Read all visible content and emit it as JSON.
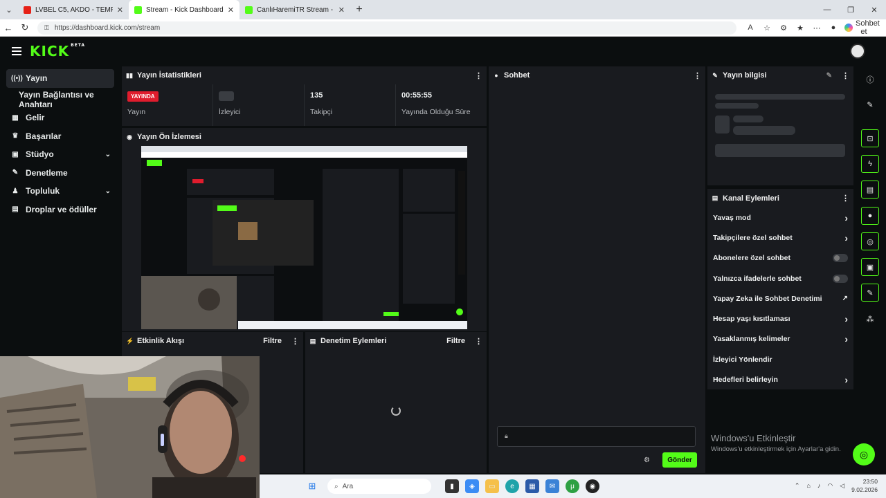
{
  "browser": {
    "tabs": [
      {
        "title": "LVBEL C5, AKDO - TEMPO - YouTu",
        "active": false,
        "favicon_color": "#e62117"
      },
      {
        "title": "Stream - Kick Dashboard",
        "active": true,
        "favicon_color": "#53fc18"
      },
      {
        "title": "CanlıHaremiTR Stream - Watch L",
        "active": false,
        "favicon_color": "#53fc18"
      }
    ],
    "url": "https://dashboard.kick.com/stream",
    "chat_label": "Sohbet et"
  },
  "header": {
    "logo": "KICK",
    "logo_badge": "BETA"
  },
  "sidebar": {
    "items": [
      {
        "label": "Yayın",
        "icon": "broadcast-icon"
      },
      {
        "label": "Yayın Bağlantısı ve Anahtarı",
        "icon": ""
      },
      {
        "label": "Gelir",
        "icon": "chart-icon"
      },
      {
        "label": "Başarılar",
        "icon": "trophy-icon"
      },
      {
        "label": "Stüdyo",
        "icon": "film-icon"
      },
      {
        "label": "Denetleme",
        "icon": "wrench-icon"
      },
      {
        "label": "Topluluk",
        "icon": "users-icon"
      },
      {
        "label": "Droplar ve ödüller",
        "icon": "gift-icon"
      }
    ]
  },
  "stats": {
    "title": "Yayın İstatistikleri",
    "live_badge": "YAYINDA",
    "items": [
      {
        "value": "",
        "label": "Yayın"
      },
      {
        "value": "",
        "label": "İzleyici"
      },
      {
        "value": "135",
        "label": "Takipçi"
      },
      {
        "value": "00:55:55",
        "label": "Yayında Olduğu Süre"
      }
    ]
  },
  "preview": {
    "title": "Yayın Ön İzlemesi"
  },
  "activity": {
    "title": "Etkinlik Akışı",
    "filter": "Filtre"
  },
  "moderation": {
    "title": "Denetim Eylemleri",
    "filter": "Filtre"
  },
  "chat": {
    "title": "Sohbet",
    "send": "Gönder"
  },
  "stream_info": {
    "title": "Yayın bilgisi"
  },
  "channel_actions": {
    "title": "Kanal Eylemleri",
    "items": [
      {
        "label": "Yavaş mod",
        "control": "chevron"
      },
      {
        "label": "Takipçilere özel sohbet",
        "control": "chevron"
      },
      {
        "label": "Abonelere özel sohbet",
        "control": "toggle"
      },
      {
        "label": "Yalnızca ifadelerle sohbet",
        "control": "toggle"
      },
      {
        "label": "Yapay Zeka ile Sohbet Denetimi",
        "control": "external"
      },
      {
        "label": "Hesap yaşı kısıtlaması",
        "control": "chevron"
      },
      {
        "label": "Yasaklanmış kelimeler",
        "control": "chevron"
      },
      {
        "label": "İzleyici Yönlendir",
        "control": "none"
      },
      {
        "label": "Hedefleri belirleyin",
        "control": "chevron"
      }
    ]
  },
  "windows_activation": {
    "title": "Windows'u Etkinleştir",
    "subtitle": "Windows'u etkinleştirmek için Ayarlar'a gidin."
  },
  "taskbar": {
    "search_placeholder": "Ara",
    "time": "23:50",
    "date": "9.02.2026"
  },
  "colors": {
    "accent": "#53fc18",
    "live": "#e01c2d",
    "panel": "#191b1f",
    "background": "#0b0e0f"
  }
}
